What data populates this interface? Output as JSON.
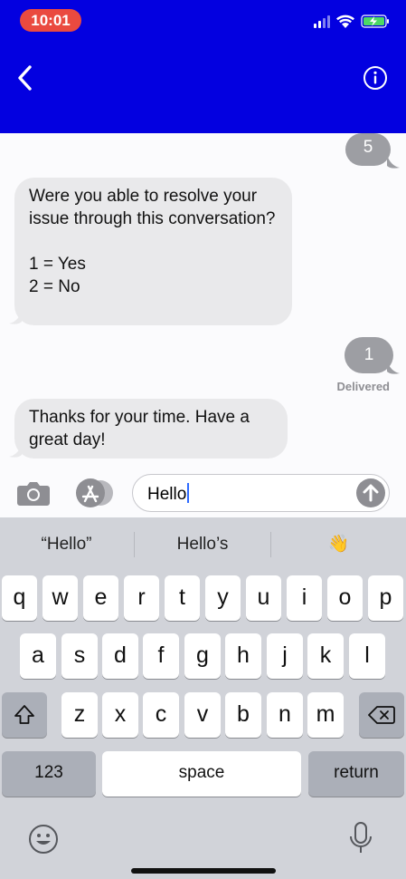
{
  "status": {
    "time": "10:01"
  },
  "colors": {
    "header": "#0300e0",
    "time_pill": "#ea4a3f",
    "incoming_bubble": "#e9e9eb",
    "outgoing_bubble": "#9d9ea3"
  },
  "icons": {
    "back": "chevron-left-icon",
    "info": "info-icon",
    "camera": "camera-icon",
    "appstore": "app-store-icon",
    "send": "arrow-up-icon",
    "shift": "shift-icon",
    "backspace": "backspace-icon",
    "emoji": "emoji-icon",
    "mic": "microphone-icon"
  },
  "messages": {
    "out_top": "5",
    "question": "Were you able to resolve your issue through this conversation?\n\n1 = Yes\n2 = No",
    "out_reply": "1",
    "delivered": "Delivered",
    "thanks": "Thanks for your time.  Have a great day!"
  },
  "compose": {
    "value": "Hello"
  },
  "keyboard": {
    "suggestions": [
      "“Hello”",
      "Hello’s",
      "👋"
    ],
    "row1": [
      "q",
      "w",
      "e",
      "r",
      "t",
      "y",
      "u",
      "i",
      "o",
      "p"
    ],
    "row2": [
      "a",
      "s",
      "d",
      "f",
      "g",
      "h",
      "j",
      "k",
      "l"
    ],
    "row3": [
      "z",
      "x",
      "c",
      "v",
      "b",
      "n",
      "m"
    ],
    "numbers": "123",
    "space": "space",
    "return": "return"
  }
}
